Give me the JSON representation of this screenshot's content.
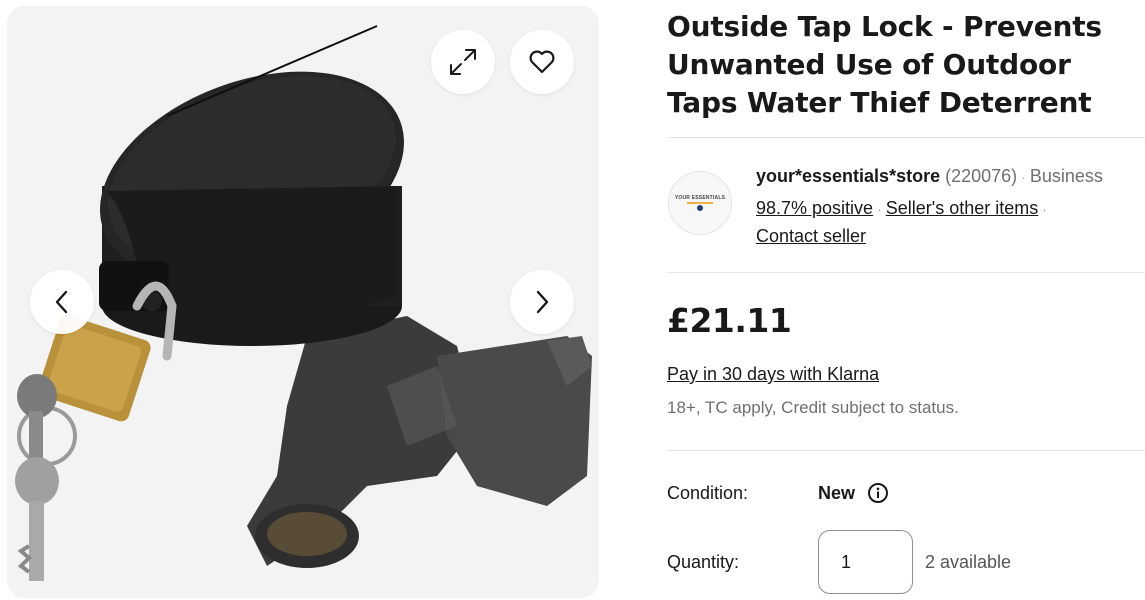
{
  "gallery": {
    "image_alt": "Outside tap lock on outdoor tap with padlock and keys",
    "prev_icon": "chevron-left-icon",
    "next_icon": "chevron-right-icon",
    "expand_icon": "expand-icon",
    "watch_icon": "heart-icon"
  },
  "listing": {
    "title": "Outside Tap Lock - Prevents Unwanted Use of Outdoor Taps Water Thief Deterrent"
  },
  "seller": {
    "name": "your*essentials*store",
    "feedback_count": "(220076)",
    "type": "Business",
    "positive": "98.7% positive",
    "other_items": "Seller's other items",
    "contact": "Contact seller",
    "avatar_text": "YOUR ESSENTIALS"
  },
  "price": {
    "amount": "£21.11",
    "klarna": "Pay in 30 days with Klarna",
    "credit_note": "18+, TC apply, Credit subject to status."
  },
  "condition": {
    "label": "Condition:",
    "value": "New",
    "icon": "info-icon"
  },
  "quantity": {
    "label": "Quantity:",
    "value": "1",
    "available": "2 available"
  },
  "colors": {
    "text": "#191919",
    "muted": "#707070",
    "divider": "#e5e5e5"
  }
}
